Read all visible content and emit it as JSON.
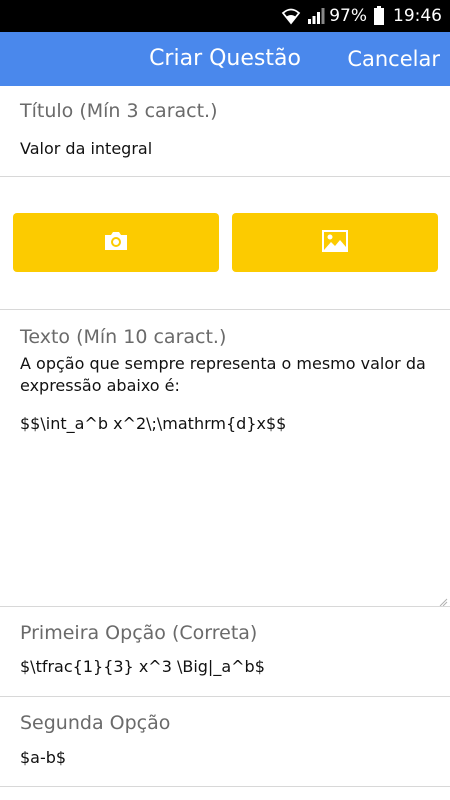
{
  "status_bar": {
    "battery": "97%",
    "time": "19:46"
  },
  "app_bar": {
    "title": "Criar Questão",
    "cancel_label": "Cancelar"
  },
  "title_field": {
    "label": "Título (Mín 3 caract.)",
    "value": "Valor da integral"
  },
  "media_buttons": {
    "camera_icon": "camera-icon",
    "gallery_icon": "image-icon",
    "color": "#fccb00"
  },
  "text_field": {
    "label": "Texto (Mín 10 caract.)",
    "line1": "A opção que sempre representa o mesmo valor da expressão abaixo é:",
    "line2": "$$\\int_a^b x^2\\;\\mathrm{d}x$$"
  },
  "option1": {
    "label": "Primeira Opção (Correta)",
    "value": "$\\tfrac{1}{3} x^3 \\Big|_a^b$"
  },
  "option2": {
    "label": "Segunda Opção",
    "value": "$a-b$"
  },
  "colors": {
    "app_bar": "#4a88ec",
    "accent": "#fccb00"
  }
}
